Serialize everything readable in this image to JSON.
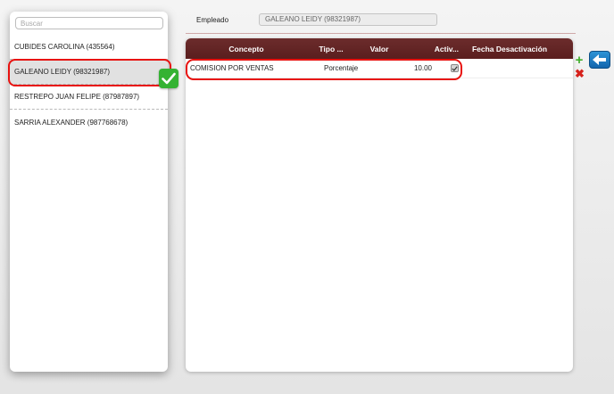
{
  "employee_list": {
    "search_placeholder": "Buscar",
    "items": [
      {
        "label": "CUBIDES CAROLINA (435564)",
        "selected": false
      },
      {
        "label": "GALEANO LEIDY (98321987)",
        "selected": true
      },
      {
        "label": "RESTREPO JUAN FELIPE (87987897)",
        "selected": false
      },
      {
        "label": "SARRIA ALEXANDER (987768678)",
        "selected": false
      }
    ]
  },
  "header": {
    "employee_label": "Empleado",
    "employee_value": "GALEANO  LEIDY (98321987)"
  },
  "grid": {
    "columns": [
      "Concepto",
      "Tipo ...",
      "Valor",
      "Activ...",
      "Fecha Desactivación"
    ],
    "rows": [
      {
        "concepto": "COMISION POR VENTAS",
        "tipo": "Porcentaje",
        "valor": "10.00",
        "activo": true,
        "fecha": ""
      }
    ]
  },
  "colors": {
    "header_bg": "#5e2222",
    "highlight": "#e8120f",
    "check_badge": "#34b233"
  },
  "icons": {
    "add": "plus-icon",
    "delete": "x-icon",
    "back": "arrow-left-icon",
    "confirm": "checkmark-icon"
  }
}
